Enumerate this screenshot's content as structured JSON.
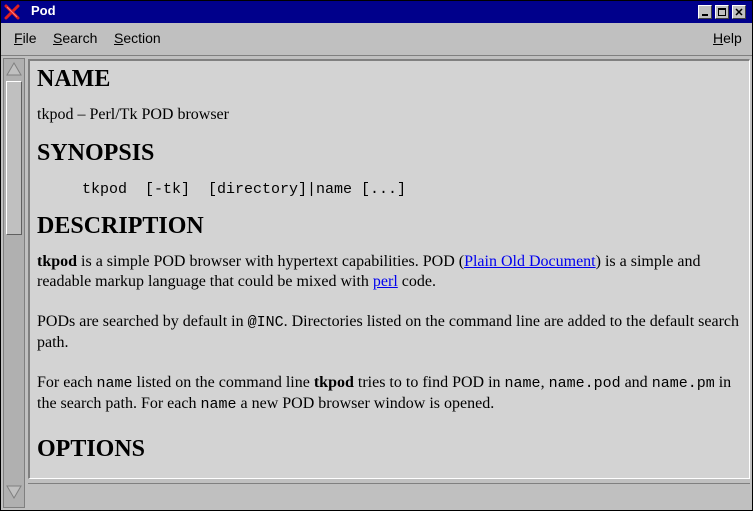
{
  "window": {
    "title": "Pod",
    "icon": "x-icon",
    "controls": [
      "minimize-icon",
      "maximize-icon",
      "close-icon"
    ],
    "colors": {
      "titlebar": "#00008b",
      "link": "#0000ee",
      "content_bg": "#d3d3d3"
    }
  },
  "menu": {
    "file": {
      "first": "F",
      "rest": "ile"
    },
    "search": {
      "first": "S",
      "rest": "earch"
    },
    "section": {
      "first": "S",
      "rest": "ection"
    },
    "help": {
      "first": "H",
      "rest": "elp"
    }
  },
  "doc": {
    "name_heading": "NAME",
    "name_text": "tkpod – Perl/Tk POD browser",
    "synopsis_heading": "SYNOPSIS",
    "synopsis_text": "tkpod  [-tk]  [directory]|name [...]",
    "description_heading": "DESCRIPTION",
    "p1": {
      "bold": "tkpod",
      "t1": " is a simple POD browser with hypertext capabilities. POD (",
      "link1": "Plain Old Document",
      "t2": ") is a simple and readable markup language that could be mixed with ",
      "link2": "perl",
      "t3": " code."
    },
    "p2": {
      "t1": "PODs are searched by default in ",
      "code": "@INC",
      "t2": ".  Directories listed on the command line are added to the default search path."
    },
    "p3": {
      "t1": "For each ",
      "code1": "name",
      "t2": " listed on the command line ",
      "bold": "tkpod",
      "t3": " tries to to find POD in ",
      "code2": "name",
      "t4": ", ",
      "code3": "name.pod",
      "t5": " and ",
      "code4": "name.pm",
      "t6": " in the search path.  For each ",
      "code5": "name",
      "t7": " a new POD browser window is opened."
    },
    "options_heading": "OPTIONS"
  }
}
